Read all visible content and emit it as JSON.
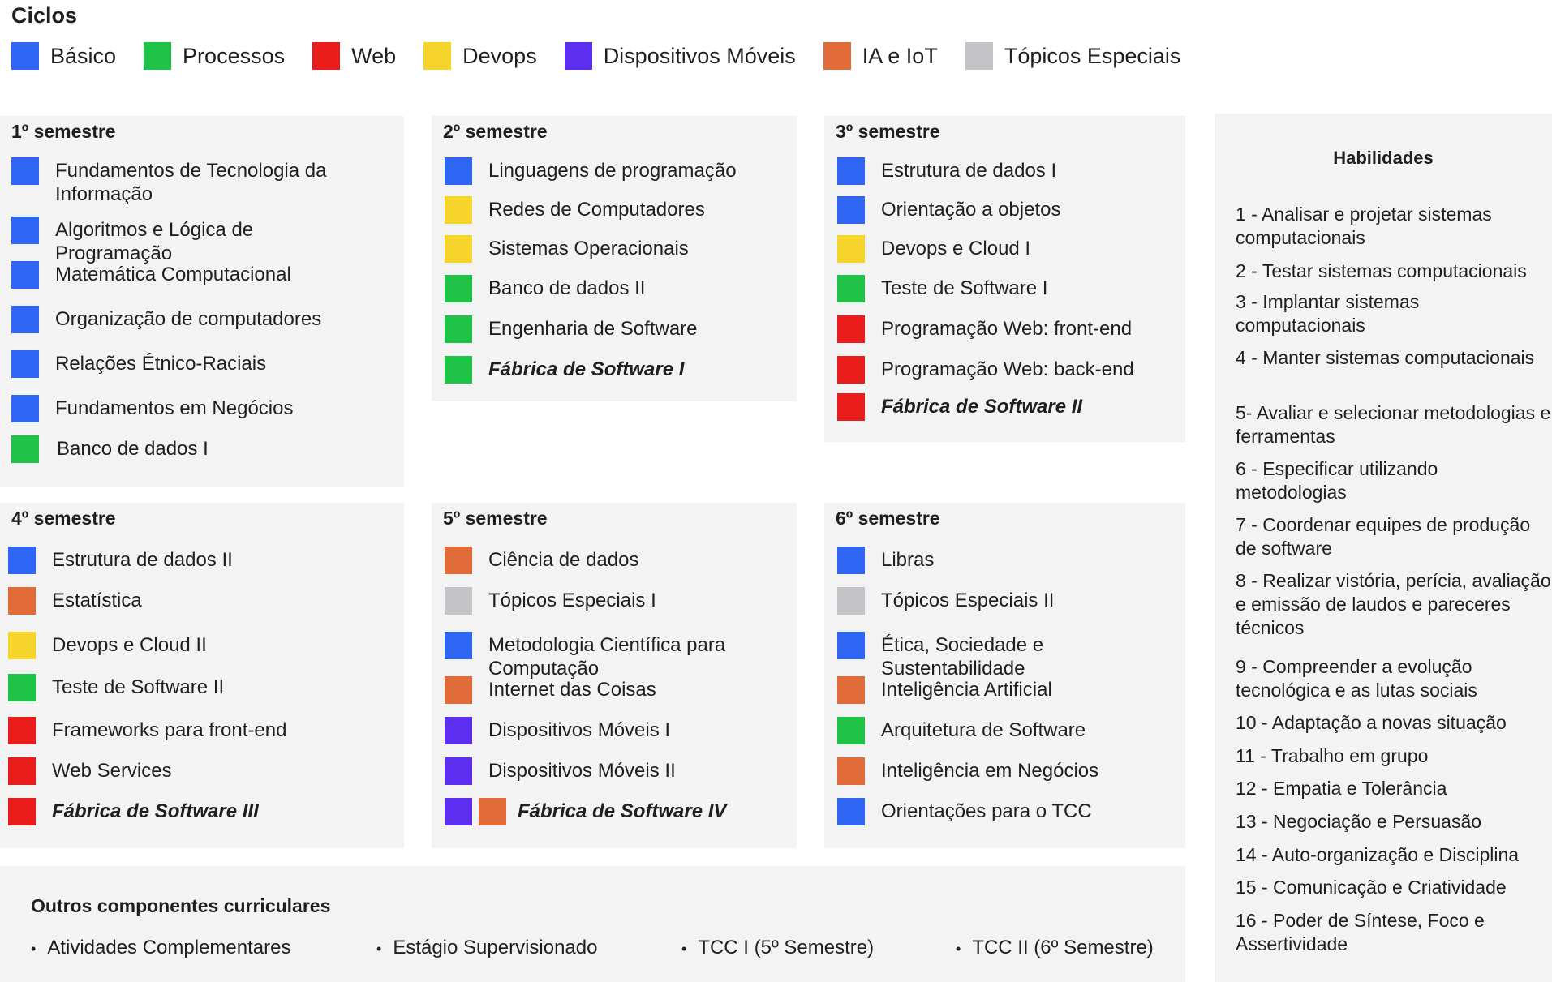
{
  "legend": {
    "title": "Ciclos",
    "items": [
      {
        "label": "Básico",
        "color": "#2f66f3"
      },
      {
        "label": "Processos",
        "color": "#1fc348"
      },
      {
        "label": "Web",
        "color": "#ea1c1c"
      },
      {
        "label": "Devops",
        "color": "#f6d42c"
      },
      {
        "label": "Dispositivos Móveis",
        "color": "#5b2ef0"
      },
      {
        "label": "IA e IoT",
        "color": "#e26c39"
      },
      {
        "label": "Tópicos Especiais",
        "color": "#c4c4c8"
      }
    ]
  },
  "semesters": [
    {
      "title": "1º semestre",
      "courses": [
        {
          "label": "Fundamentos de Tecnologia da Informação",
          "colors": [
            "#2f66f3"
          ]
        },
        {
          "label": "Algoritmos e Lógica de Programação",
          "colors": [
            "#2f66f3"
          ]
        },
        {
          "label": "Matemática Computacional",
          "colors": [
            "#2f66f3"
          ]
        },
        {
          "label": "Organização de computadores",
          "colors": [
            "#2f66f3"
          ]
        },
        {
          "label": "Relações Étnico-Raciais",
          "colors": [
            "#2f66f3"
          ]
        },
        {
          "label": "Fundamentos em Negócios",
          "colors": [
            "#2f66f3"
          ]
        },
        {
          "label": "Banco de dados I",
          "colors": [
            "#1fc348"
          ]
        }
      ]
    },
    {
      "title": "2º semestre",
      "courses": [
        {
          "label": "Linguagens de programação",
          "colors": [
            "#2f66f3"
          ]
        },
        {
          "label": "Redes de Computadores",
          "colors": [
            "#f6d42c"
          ]
        },
        {
          "label": "Sistemas Operacionais",
          "colors": [
            "#f6d42c"
          ]
        },
        {
          "label": "Banco de dados II",
          "colors": [
            "#1fc348"
          ]
        },
        {
          "label": "Engenharia de Software",
          "colors": [
            "#1fc348"
          ]
        },
        {
          "label": "Fábrica de Software I",
          "colors": [
            "#1fc348"
          ],
          "bold": true
        }
      ]
    },
    {
      "title": "3º semestre",
      "courses": [
        {
          "label": "Estrutura de dados I",
          "colors": [
            "#2f66f3"
          ]
        },
        {
          "label": "Orientação a objetos",
          "colors": [
            "#2f66f3"
          ]
        },
        {
          "label": "Devops e Cloud I",
          "colors": [
            "#f6d42c"
          ]
        },
        {
          "label": "Teste de Software I",
          "colors": [
            "#1fc348"
          ]
        },
        {
          "label": "Programação Web: front-end",
          "colors": [
            "#ea1c1c"
          ]
        },
        {
          "label": "Programação Web: back-end",
          "colors": [
            "#ea1c1c"
          ]
        },
        {
          "label": "Fábrica de Software II",
          "colors": [
            "#ea1c1c"
          ],
          "bold": true
        }
      ]
    },
    {
      "title": "4º semestre",
      "courses": [
        {
          "label": "Estrutura de dados II",
          "colors": [
            "#2f66f3"
          ]
        },
        {
          "label": "Estatística",
          "colors": [
            "#e26c39"
          ]
        },
        {
          "label": "Devops e Cloud II",
          "colors": [
            "#f6d42c"
          ]
        },
        {
          "label": "Teste de Software II",
          "colors": [
            "#1fc348"
          ]
        },
        {
          "label": "Frameworks para front-end",
          "colors": [
            "#ea1c1c"
          ]
        },
        {
          "label": "Web Services",
          "colors": [
            "#ea1c1c"
          ]
        },
        {
          "label": "Fábrica de Software III",
          "colors": [
            "#ea1c1c"
          ],
          "bold": true
        }
      ]
    },
    {
      "title": "5º semestre",
      "courses": [
        {
          "label": "Ciência de dados",
          "colors": [
            "#e26c39"
          ]
        },
        {
          "label": "Tópicos Especiais I",
          "colors": [
            "#c4c4c8"
          ]
        },
        {
          "label": "Metodologia Científica para Computação",
          "colors": [
            "#2f66f3"
          ]
        },
        {
          "label": "Internet das Coisas",
          "colors": [
            "#e26c39"
          ]
        },
        {
          "label": "Dispositivos Móveis I",
          "colors": [
            "#5b2ef0"
          ]
        },
        {
          "label": "Dispositivos Móveis II",
          "colors": [
            "#5b2ef0"
          ]
        },
        {
          "label": "Fábrica de Software IV",
          "colors": [
            "#5b2ef0",
            "#e26c39"
          ],
          "bold": true
        }
      ]
    },
    {
      "title": "6º semestre",
      "courses": [
        {
          "label": "Libras",
          "colors": [
            "#2f66f3"
          ]
        },
        {
          "label": "Tópicos Especiais II",
          "colors": [
            "#c4c4c8"
          ]
        },
        {
          "label": "Ética, Sociedade e Sustentabilidade",
          "colors": [
            "#2f66f3"
          ]
        },
        {
          "label": "Inteligência Artificial",
          "colors": [
            "#e26c39"
          ]
        },
        {
          "label": "Arquitetura de Software",
          "colors": [
            "#1fc348"
          ]
        },
        {
          "label": "Inteligência em Negócios",
          "colors": [
            "#e26c39"
          ]
        },
        {
          "label": "Orientações para o TCC",
          "colors": [
            "#2f66f3"
          ]
        }
      ]
    }
  ],
  "skills": {
    "title": "Habilidades",
    "items": [
      "1 - Analisar e projetar sistemas computacionais",
      "2 - Testar sistemas computacionais",
      "3 - Implantar sistemas computacionais",
      "4 - Manter sistemas computacionais",
      "5- Avaliar e selecionar metodologias e ferramentas",
      "6 - Especificar utilizando metodologias",
      "7 - Coordenar equipes de produção de software",
      "8 - Realizar vistória, perícia, avaliação e emissão de laudos e pareceres técnicos",
      "9 - Compreender a evolução tecnológica e as lutas sociais",
      "10 - Adaptação a novas situação",
      "11 - Trabalho em grupo",
      "12 - Empatia e Tolerância",
      "13 - Negociação e Persuasão",
      "14 - Auto-organização e Disciplina",
      "15 - Comunicação e Criatividade",
      "16 - Poder de Síntese, Foco e Assertividade"
    ]
  },
  "others": {
    "title": "Outros componentes curriculares",
    "items": [
      "Atividades Complementares",
      "Estágio Supervisionado",
      "TCC I (5º Semestre)",
      "TCC II (6º Semestre)"
    ]
  }
}
